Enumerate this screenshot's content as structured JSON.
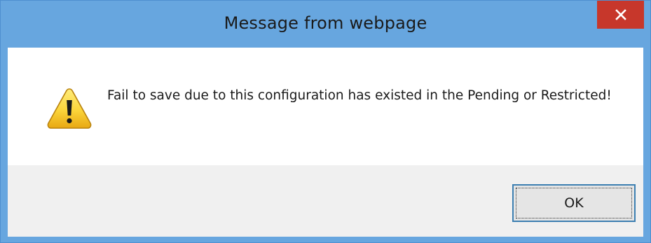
{
  "dialog": {
    "title": "Message from webpage",
    "close_icon": "close-icon",
    "warning_icon": "warning-triangle-icon",
    "message": "Fail to save due to this configuration has existed in the Pending or Restricted!",
    "ok_label": "OK"
  },
  "colors": {
    "titlebar": "#67a6df",
    "close_button": "#c7372b",
    "button_area": "#f0f0f0",
    "ok_border": "#3c7fb1"
  }
}
